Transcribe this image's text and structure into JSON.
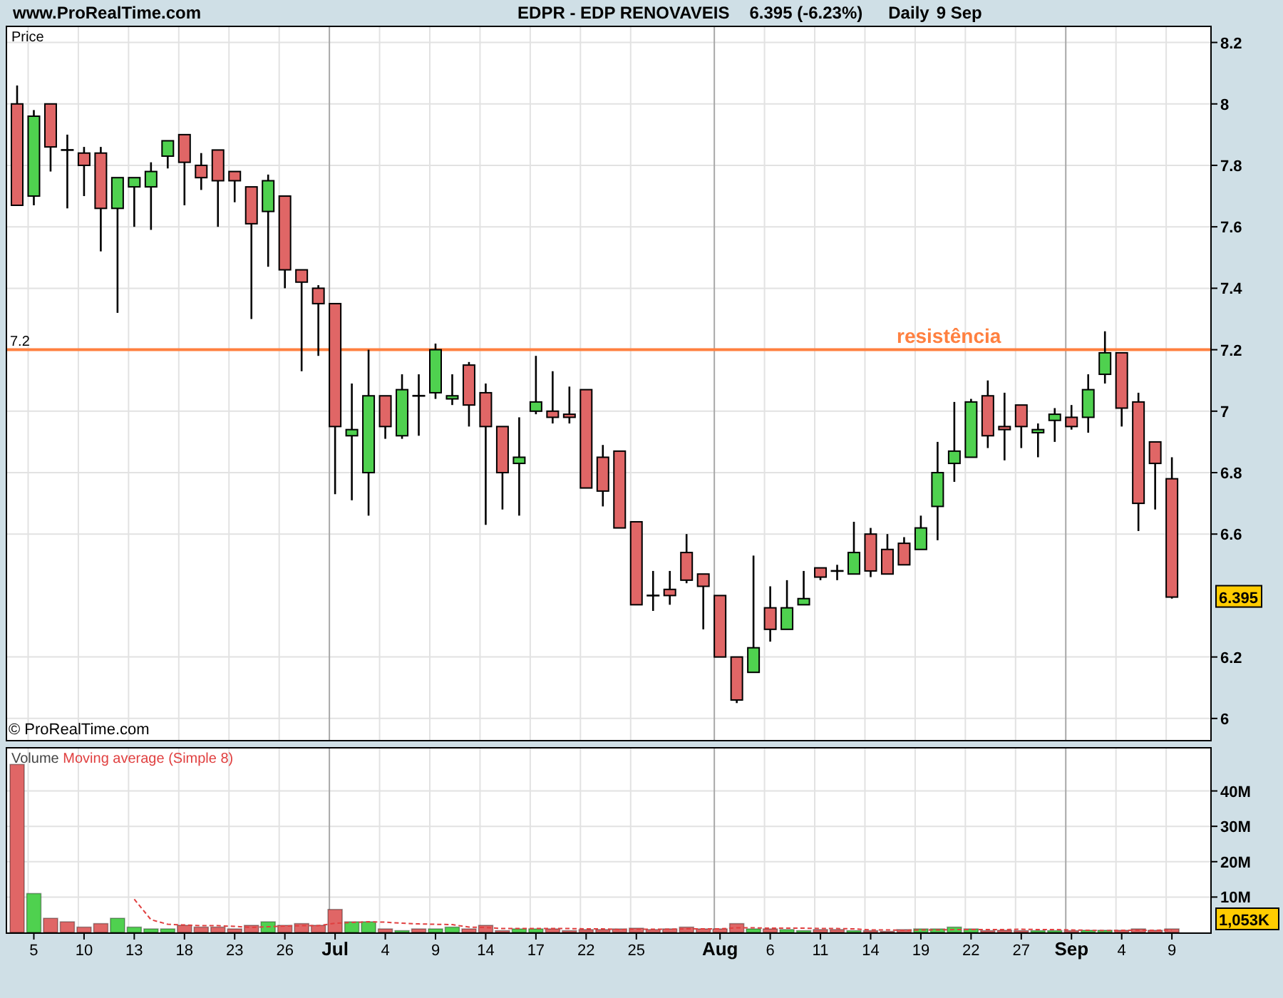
{
  "header": {
    "site": "www.ProRealTime.com",
    "title": "EDPR - EDP RENOVAVEIS",
    "quote": "6.395 (-6.23%)",
    "period": "Daily",
    "date": "9 Sep"
  },
  "price_panel": {
    "copyright": "© ProRealTime.com",
    "last_price": "6.395",
    "line_label": "7.2",
    "chart_data": {
      "type": "candlestick",
      "title": "Price",
      "grid": true,
      "ohlc": [
        [
          8.0,
          8.06,
          7.67,
          7.67
        ],
        [
          7.7,
          7.98,
          7.67,
          7.96
        ],
        [
          8.0,
          8.0,
          7.78,
          7.86
        ],
        [
          7.85,
          7.9,
          7.66,
          7.85
        ],
        [
          7.84,
          7.86,
          7.7,
          7.8
        ],
        [
          7.84,
          7.86,
          7.52,
          7.66
        ],
        [
          7.66,
          7.76,
          7.32,
          7.76
        ],
        [
          7.73,
          7.76,
          7.6,
          7.76
        ],
        [
          7.73,
          7.81,
          7.59,
          7.78
        ],
        [
          7.83,
          7.88,
          7.79,
          7.88
        ],
        [
          7.9,
          7.9,
          7.67,
          7.81
        ],
        [
          7.8,
          7.84,
          7.72,
          7.76
        ],
        [
          7.85,
          7.85,
          7.6,
          7.75
        ],
        [
          7.78,
          7.78,
          7.68,
          7.75
        ],
        [
          7.73,
          7.73,
          7.3,
          7.61
        ],
        [
          7.65,
          7.77,
          7.47,
          7.75
        ],
        [
          7.7,
          7.7,
          7.4,
          7.46
        ],
        [
          7.46,
          7.46,
          7.13,
          7.42
        ],
        [
          7.4,
          7.41,
          7.18,
          7.35
        ],
        [
          7.35,
          7.35,
          6.73,
          6.95
        ],
        [
          6.92,
          7.09,
          6.71,
          6.94
        ],
        [
          6.8,
          7.2,
          6.66,
          7.05
        ],
        [
          7.05,
          7.05,
          6.91,
          6.95
        ],
        [
          6.92,
          7.12,
          6.91,
          7.07
        ],
        [
          7.05,
          7.12,
          6.92,
          7.05
        ],
        [
          7.06,
          7.22,
          7.04,
          7.2
        ],
        [
          7.04,
          7.12,
          7.02,
          7.05
        ],
        [
          7.15,
          7.16,
          6.95,
          7.02
        ],
        [
          7.06,
          7.09,
          6.63,
          6.95
        ],
        [
          6.95,
          6.95,
          6.68,
          6.8
        ],
        [
          6.83,
          6.98,
          6.66,
          6.85
        ],
        [
          7.0,
          7.18,
          6.99,
          7.03
        ],
        [
          7.0,
          7.13,
          6.96,
          6.98
        ],
        [
          6.99,
          7.08,
          6.96,
          6.98
        ],
        [
          7.07,
          7.07,
          6.75,
          6.75
        ],
        [
          6.85,
          6.89,
          6.69,
          6.74
        ],
        [
          6.87,
          6.87,
          6.62,
          6.62
        ],
        [
          6.64,
          6.64,
          6.37,
          6.37
        ],
        [
          6.4,
          6.48,
          6.35,
          6.4
        ],
        [
          6.42,
          6.48,
          6.37,
          6.4
        ],
        [
          6.54,
          6.6,
          6.44,
          6.45
        ],
        [
          6.47,
          6.47,
          6.29,
          6.43
        ],
        [
          6.4,
          6.4,
          6.2,
          6.2
        ],
        [
          6.2,
          6.2,
          6.05,
          6.06
        ],
        [
          6.15,
          6.53,
          6.15,
          6.23
        ],
        [
          6.36,
          6.43,
          6.25,
          6.29
        ],
        [
          6.29,
          6.45,
          6.29,
          6.36
        ],
        [
          6.37,
          6.48,
          6.37,
          6.39
        ],
        [
          6.49,
          6.49,
          6.45,
          6.46
        ],
        [
          6.48,
          6.5,
          6.45,
          6.48
        ],
        [
          6.47,
          6.64,
          6.47,
          6.54
        ],
        [
          6.6,
          6.62,
          6.46,
          6.48
        ],
        [
          6.55,
          6.6,
          6.47,
          6.47
        ],
        [
          6.57,
          6.59,
          6.5,
          6.5
        ],
        [
          6.55,
          6.66,
          6.55,
          6.62
        ],
        [
          6.69,
          6.9,
          6.58,
          6.8
        ],
        [
          6.83,
          7.03,
          6.77,
          6.87
        ],
        [
          6.85,
          7.04,
          6.85,
          7.03
        ],
        [
          7.05,
          7.1,
          6.88,
          6.92
        ],
        [
          6.95,
          7.06,
          6.84,
          6.94
        ],
        [
          7.02,
          7.02,
          6.88,
          6.95
        ],
        [
          6.93,
          6.96,
          6.85,
          6.94
        ],
        [
          6.97,
          7.01,
          6.9,
          6.99
        ],
        [
          6.98,
          7.02,
          6.94,
          6.95
        ],
        [
          6.98,
          7.12,
          6.93,
          7.07
        ],
        [
          7.12,
          7.26,
          7.09,
          7.19
        ],
        [
          7.19,
          7.19,
          6.95,
          7.01
        ],
        [
          7.03,
          7.06,
          6.61,
          6.7
        ],
        [
          6.9,
          6.9,
          6.68,
          6.83
        ],
        [
          6.78,
          6.85,
          6.39,
          6.395
        ]
      ],
      "ylim": [
        5.93,
        8.25
      ],
      "yticks": [
        6,
        6.2,
        6.6,
        6.8,
        7,
        7.2,
        7.4,
        7.6,
        7.8,
        8,
        8.2
      ],
      "ref_lines": [
        {
          "axis": "y",
          "value": 7.2,
          "label": "resistência"
        }
      ]
    }
  },
  "volume_panel": {
    "last_volume": "1,053K",
    "chart_data": {
      "type": "bar",
      "grid": true,
      "series": [
        {
          "name": "Volume",
          "colors": [
            "#e06666",
            "#4fd14f",
            "#e06666",
            "#e06666",
            "#e06666",
            "#e06666",
            "#4fd14f",
            "#4fd14f",
            "#4fd14f",
            "#4fd14f",
            "#e06666",
            "#e06666",
            "#e06666",
            "#e06666",
            "#e06666",
            "#4fd14f",
            "#e06666",
            "#e06666",
            "#e06666",
            "#e06666",
            "#4fd14f",
            "#4fd14f",
            "#e06666",
            "#4fd14f",
            "#e06666",
            "#4fd14f",
            "#4fd14f",
            "#e06666",
            "#e06666",
            "#e06666",
            "#4fd14f",
            "#4fd14f",
            "#e06666",
            "#e06666",
            "#e06666",
            "#e06666",
            "#e06666",
            "#e06666",
            "#e06666",
            "#e06666",
            "#e06666",
            "#e06666",
            "#e06666",
            "#e06666",
            "#4fd14f",
            "#e06666",
            "#4fd14f",
            "#4fd14f",
            "#e06666",
            "#e06666",
            "#4fd14f",
            "#e06666",
            "#e06666",
            "#e06666",
            "#4fd14f",
            "#4fd14f",
            "#4fd14f",
            "#4fd14f",
            "#e06666",
            "#e06666",
            "#e06666",
            "#4fd14f",
            "#4fd14f",
            "#e06666",
            "#4fd14f",
            "#4fd14f",
            "#e06666",
            "#e06666",
            "#e06666",
            "#e06666"
          ],
          "values": [
            47.5,
            11,
            4,
            3,
            1.5,
            2.5,
            4,
            1.5,
            1,
            1,
            2,
            1.5,
            1.5,
            1,
            2,
            3,
            2,
            2.5,
            2,
            6.5,
            3,
            3,
            1,
            0.5,
            1,
            1,
            1.5,
            1,
            2,
            0.5,
            1,
            1,
            1,
            0.5,
            0.8,
            0.8,
            1,
            1.2,
            0.8,
            1,
            1.5,
            1,
            1,
            2.5,
            1,
            1,
            0.8,
            0.5,
            0.8,
            0.8,
            0.5,
            0.5,
            0.3,
            0.8,
            1,
            1,
            1.5,
            1,
            0.5,
            0.6,
            0.5,
            0.5,
            0.5,
            0.5,
            0.6,
            0.6,
            0.6,
            1,
            0.6,
            1
          ]
        },
        {
          "name": "Moving average (Simple 8)",
          "type": "line",
          "line_style": "dashed",
          "color": "#e04040",
          "values": [
            null,
            null,
            null,
            null,
            null,
            null,
            null,
            9.4,
            3.6,
            2.3,
            2.1,
            1.9,
            1.9,
            1.7,
            1.4,
            1.6,
            1.8,
            1.9,
            1.9,
            2.6,
            2.8,
            3.0,
            2.9,
            2.6,
            2.4,
            2.3,
            2.2,
            1.5,
            1.4,
            1.1,
            1.1,
            1.1,
            1.1,
            1.1,
            1.0,
            1.0,
            0.8,
            0.9,
            0.9,
            0.9,
            1.0,
            1.0,
            1.0,
            1.3,
            1.3,
            1.2,
            1.2,
            1.2,
            1.1,
            1.1,
            1.0,
            0.7,
            0.7,
            0.6,
            0.7,
            0.7,
            0.8,
            0.8,
            0.8,
            0.8,
            0.9,
            0.8,
            0.8,
            0.7,
            0.6,
            0.5,
            0.6,
            0.6,
            0.6,
            0.7
          ]
        }
      ],
      "ylim": [
        0,
        52
      ],
      "yticks": [
        {
          "value": 10,
          "label": "10M"
        },
        {
          "value": 20,
          "label": "20M"
        },
        {
          "value": 30,
          "label": "30M"
        },
        {
          "value": 40,
          "label": "40M"
        }
      ]
    }
  },
  "date_axis": {
    "groups": [
      {
        "labels": [
          {
            "label": "5",
            "kind": "day"
          },
          {
            "label": "10",
            "kind": "day"
          },
          {
            "label": "13",
            "kind": "day"
          },
          {
            "label": "18",
            "kind": "day"
          },
          {
            "label": "23",
            "kind": "day"
          },
          {
            "label": "26",
            "kind": "day"
          },
          {
            "label": "Jul",
            "kind": "month"
          },
          {
            "label": "4",
            "kind": "day"
          },
          {
            "label": "9",
            "kind": "day"
          },
          {
            "label": "14",
            "kind": "day"
          },
          {
            "label": "17",
            "kind": "day"
          },
          {
            "label": "22",
            "kind": "day"
          },
          {
            "label": "25",
            "kind": "day"
          }
        ]
      },
      {
        "labels": [
          {
            "label": "Aug",
            "kind": "month"
          },
          {
            "label": "6",
            "kind": "day"
          },
          {
            "label": "11",
            "kind": "day"
          },
          {
            "label": "14",
            "kind": "day"
          },
          {
            "label": "19",
            "kind": "day"
          },
          {
            "label": "22",
            "kind": "day"
          },
          {
            "label": "27",
            "kind": "day"
          },
          {
            "label": "Sep",
            "kind": "month"
          },
          {
            "label": "4",
            "kind": "day"
          },
          {
            "label": "9",
            "kind": "day"
          }
        ]
      }
    ]
  }
}
